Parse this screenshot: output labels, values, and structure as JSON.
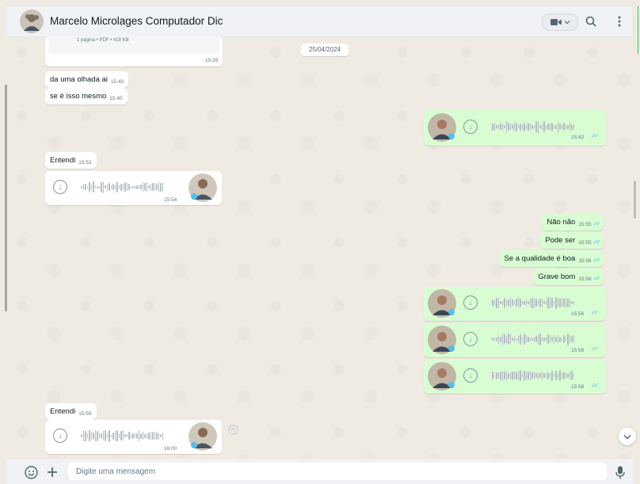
{
  "header": {
    "contact_name": "Marcelo Microlages Computador Dic"
  },
  "date_separator": "25/04/2024",
  "document": {
    "meta": "1 página • PDF • 418 KB",
    "time": "15:39"
  },
  "messages": [
    {
      "text": "da uma olhada ai",
      "time": "15:40"
    },
    {
      "text": "se é isso mesmo",
      "time": "15:40"
    },
    {
      "time": "15:42"
    },
    {
      "text": "Entendi",
      "time": "15:53"
    },
    {
      "time": "15:54"
    },
    {
      "text": "Não não",
      "time": "15:55"
    },
    {
      "text": "Pode ser",
      "time": "15:55"
    },
    {
      "text": "Se a qualidade é boa",
      "time": "15:56"
    },
    {
      "text": "Grave bom",
      "time": "15:56"
    },
    {
      "time": "15:56"
    },
    {
      "time": "15:56"
    },
    {
      "time": "15:58"
    },
    {
      "text": "Entendi",
      "time": "15:59"
    },
    {
      "time": "16:00"
    }
  ],
  "ticks": "✓✓",
  "composer": {
    "placeholder": "Digite uma mensagem"
  },
  "colors": {
    "incoming_bubble": "#ffffff",
    "outgoing_bubble": "#d9fdd3",
    "read_ticks": "#53bdeb",
    "chat_background": "#efeae2"
  },
  "icons": {
    "video": "video-call-icon",
    "search": "search-icon",
    "menu": "menu-dots-icon",
    "emoji": "emoji-icon",
    "attach": "plus-icon",
    "mic": "microphone-icon",
    "download": "download-icon",
    "scroll": "chevron-down-icon"
  }
}
